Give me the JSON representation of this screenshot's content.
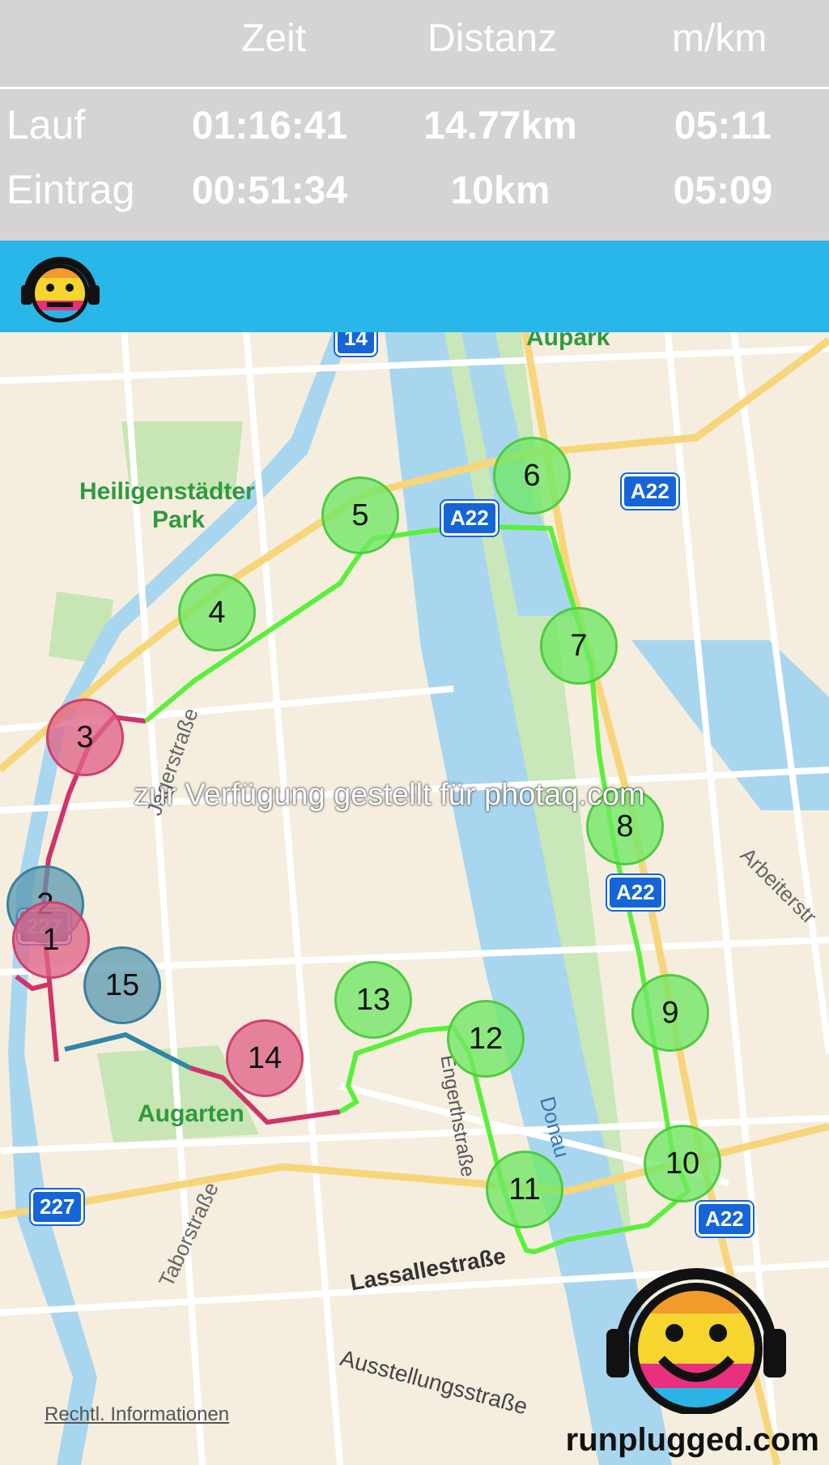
{
  "stats": {
    "headers": {
      "time": "Zeit",
      "distance": "Distanz",
      "pace": "m/km"
    },
    "rows": [
      {
        "label": "Lauf",
        "time": "01:16:41",
        "distance": "14.77km",
        "pace": "05:11"
      },
      {
        "label": "Eintrag",
        "time": "00:51:34",
        "distance": "10km",
        "pace": "05:09"
      }
    ]
  },
  "map": {
    "labels": {
      "aupark": "Aupark",
      "park": "Heiligenstädter",
      "park2": "Park",
      "augarten": "Augarten",
      "jaegerstrasse": "Jägerstraße",
      "taborstrasse": "Taborstraße",
      "lassallestrasse": "Lassallestraße",
      "ausstellungsstrasse": "Ausstellungsstraße",
      "donau": "Donau",
      "arbeiterstr": "Arbeiterstr",
      "engerthstrasse": "Engerthstraße"
    },
    "shields": {
      "s14": "14",
      "s227a": "227",
      "s227b": "227",
      "a22a": "A22",
      "a22b": "A22",
      "a22c": "A22",
      "a22d": "A22"
    },
    "markers": [
      "1",
      "2",
      "3",
      "4",
      "5",
      "6",
      "7",
      "8",
      "9",
      "10",
      "11",
      "12",
      "13",
      "14",
      "15"
    ],
    "legal": "Rechtl. Informationen"
  },
  "watermark": "zur Verfügung gestellt für photaq.com",
  "brand": "runplugged.com",
  "colors": {
    "header_bar": "#29b6e8",
    "route_green": "#5af03a",
    "route_red": "#d0336a",
    "route_blue": "#2f86a6"
  }
}
